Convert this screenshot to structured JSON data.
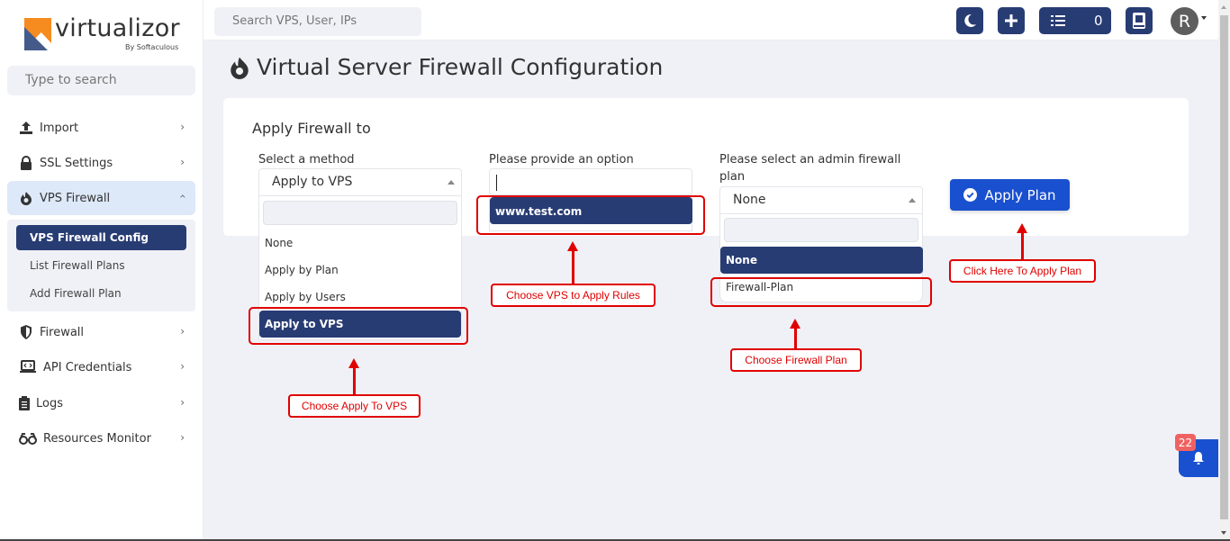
{
  "brand": {
    "name": "virtualizor",
    "sub": "By Softaculous",
    "orange": "#f68b1f",
    "blue": "#445b8a"
  },
  "sidebar": {
    "search_placeholder": "Type to search",
    "items": [
      {
        "label": "Import",
        "icon": "upload-icon"
      },
      {
        "label": "SSL Settings",
        "icon": "lock-icon"
      },
      {
        "label": "VPS Firewall",
        "icon": "fire-icon",
        "expanded": true
      },
      {
        "label": "Firewall",
        "icon": "shield-icon"
      },
      {
        "label": "API Credentials",
        "icon": "laptop-code-icon"
      },
      {
        "label": "Logs",
        "icon": "clipboard-list-icon"
      },
      {
        "label": "Resources Monitor",
        "icon": "glasses-icon"
      }
    ],
    "sub_items": [
      {
        "label": "VPS Firewall Config",
        "active": true
      },
      {
        "label": "List Firewall Plans"
      },
      {
        "label": "Add Firewall Plan"
      }
    ]
  },
  "topbar": {
    "search_placeholder": "Search VPS, User, IPs",
    "task_count": "0",
    "avatar_letter": "R"
  },
  "page": {
    "title": "Virtual Server Firewall Configuration",
    "section_title": "Apply Firewall to",
    "method": {
      "label": "Select a method",
      "value": "Apply to VPS",
      "options": [
        "None",
        "Apply by Plan",
        "Apply by Users",
        "Apply to VPS"
      ]
    },
    "option": {
      "label": "Please provide an option",
      "value": "",
      "options": [
        "www.test.com"
      ]
    },
    "plan": {
      "label_line1": "Please select an admin firewall",
      "label_line2": "plan",
      "value": "None",
      "options": [
        "None",
        "Firewall-Plan"
      ]
    },
    "apply_button": "Apply Plan"
  },
  "annotations": {
    "method": "Choose Apply To VPS",
    "option": "Choose VPS to Apply Rules",
    "plan": "Choose Firewall Plan",
    "apply": "Click Here To Apply Plan"
  },
  "notifications": {
    "count": "22"
  }
}
